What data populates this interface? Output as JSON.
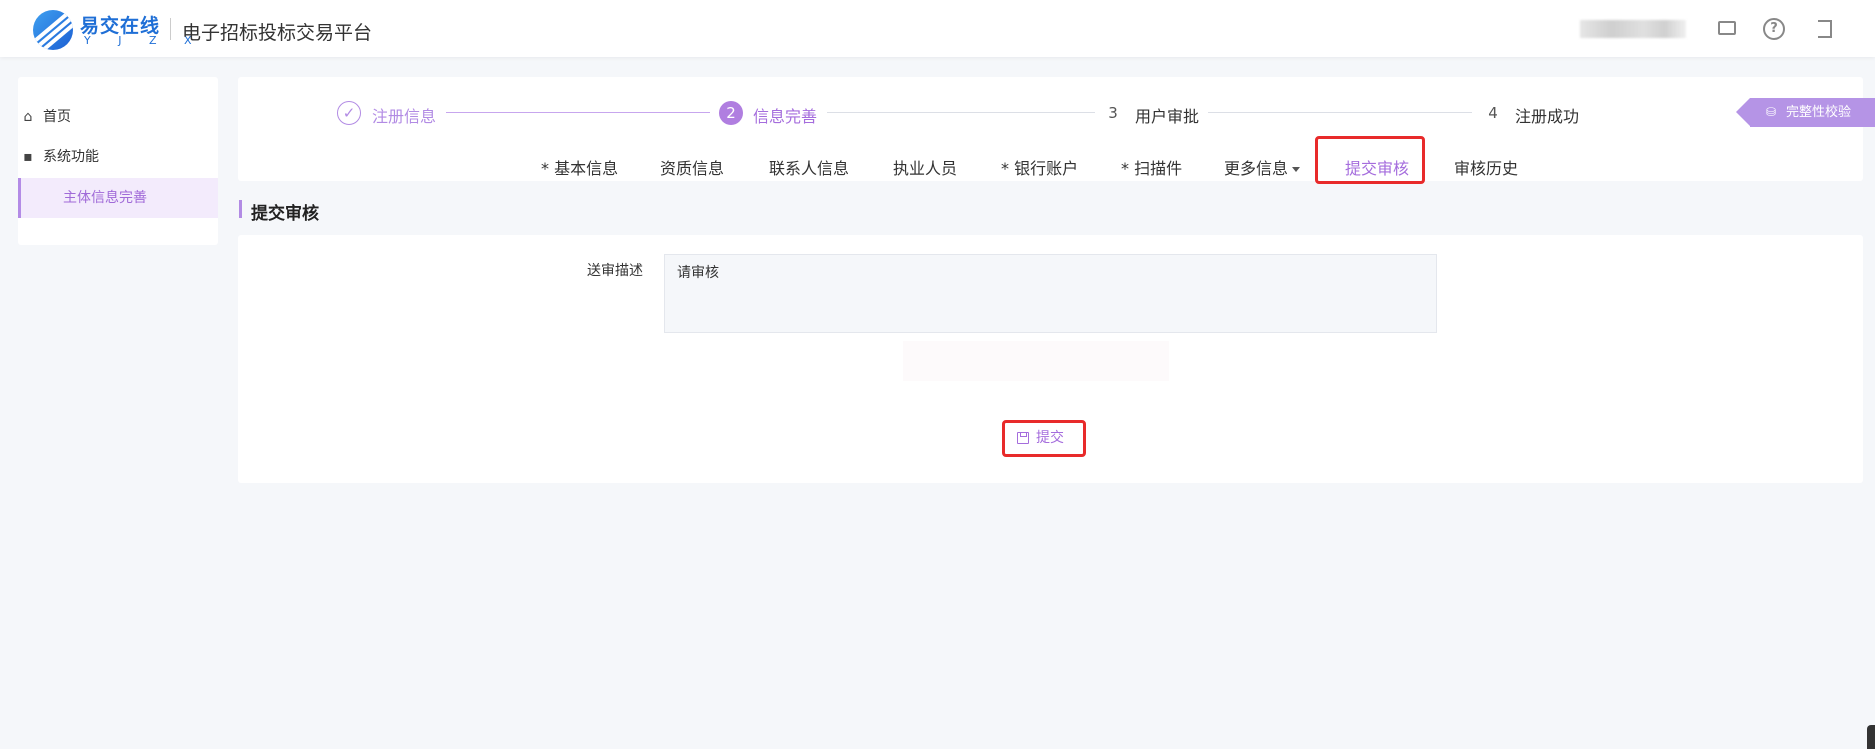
{
  "header": {
    "logo_cn": "易交在线",
    "logo_en": "Y J Z X",
    "platform_title": "电子招标投标交易平台",
    "icons": [
      "monitor-icon",
      "help-icon",
      "logout-icon"
    ]
  },
  "sidebar": {
    "items": [
      {
        "label": "首页",
        "icon": "home-icon"
      },
      {
        "label": "系统功能",
        "icon": "grid-icon"
      },
      {
        "label": "主体信息完善",
        "active": true
      }
    ]
  },
  "steps": [
    {
      "index": "✓",
      "label": "注册信息",
      "state": "done"
    },
    {
      "index": "2",
      "label": "信息完善",
      "state": "current"
    },
    {
      "index": "3",
      "label": "用户审批",
      "state": "wait"
    },
    {
      "index": "4",
      "label": "注册成功",
      "state": "wait"
    }
  ],
  "verify_button": "完整性校验",
  "tabs": [
    {
      "label": "* 基本信息"
    },
    {
      "label": "资质信息"
    },
    {
      "label": "联系人信息"
    },
    {
      "label": "执业人员"
    },
    {
      "label": "* 银行账户"
    },
    {
      "label": "* 扫描件"
    },
    {
      "label": "更多信息"
    },
    {
      "label": "提交审核",
      "active": true
    },
    {
      "label": "审核历史"
    }
  ],
  "section": {
    "title": "提交审核"
  },
  "form": {
    "desc_label": "送审描述",
    "desc_value": "请审核",
    "submit_label": "提交"
  },
  "colors": {
    "accent": "#a56ddd",
    "accent_light": "#b28be4",
    "highlight_box": "#e82a2a"
  }
}
